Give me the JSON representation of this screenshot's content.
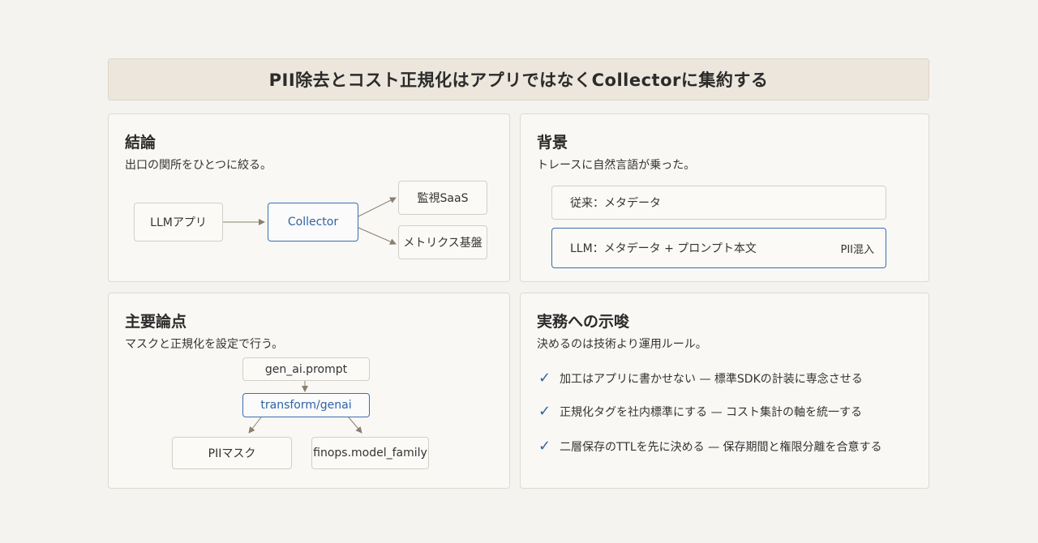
{
  "title": "PII除去とコスト正規化はアプリではなくCollectorに集約する",
  "conclusion": {
    "heading": "結論",
    "subtitle": "出口の関所をひとつに絞る。",
    "nodes": {
      "source": "LLMアプリ",
      "hub": "Collector",
      "target1": "監視SaaS",
      "target2": "メトリクス基盤"
    }
  },
  "background": {
    "heading": "背景",
    "subtitle": "トレースに自然言語が乗った。",
    "rows": [
      {
        "label": "従来：メタデータ",
        "tag": ""
      },
      {
        "label": "LLM：メタデータ + プロンプト本文",
        "tag": "PII混入"
      }
    ]
  },
  "points": {
    "heading": "主要論点",
    "subtitle": "マスクと正規化を設定で行う。",
    "nodes": {
      "input": "gen_ai.prompt",
      "processor": "transform/genai",
      "out1": "PIIマスク",
      "out2": "finops.model_family"
    }
  },
  "implications": {
    "heading": "実務への示唆",
    "subtitle": "決めるのは技術より運用ルール。",
    "check_icon": "✓",
    "items": [
      "加工はアプリに書かせない — 標準SDKの計装に専念させる",
      "正規化タグを社内標準にする — コスト集計の軸を統一する",
      "二層保存のTTLを先に決める — 保存期間と権限分離を合意する"
    ]
  },
  "colors": {
    "accent": "#2f63a6",
    "arrow": "#8a7f6f",
    "title_bg": "#ece6dc"
  }
}
